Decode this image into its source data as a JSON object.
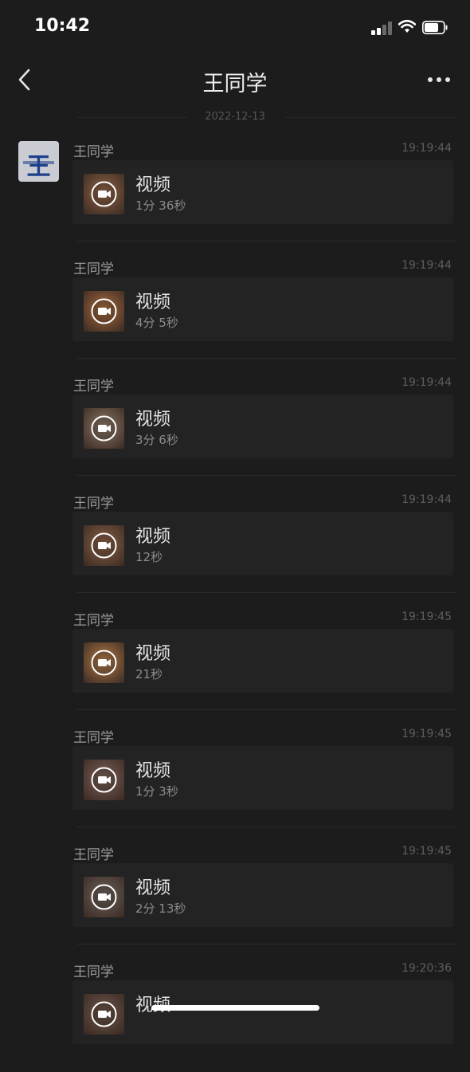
{
  "status_bar": {
    "time": "10:42"
  },
  "nav": {
    "title": "王同学"
  },
  "date_separator": "2022-12-13",
  "avatar": {
    "char": "王"
  },
  "messages": [
    {
      "sender": "王同学",
      "time": "19:19:44",
      "title": "视频",
      "duration": "1分 36秒",
      "thumb_color": "#8f6346"
    },
    {
      "sender": "王同学",
      "time": "19:19:44",
      "title": "视频",
      "duration": "4分 5秒",
      "thumb_color": "#a4693e"
    },
    {
      "sender": "王同学",
      "time": "19:19:44",
      "title": "视频",
      "duration": "3分 6秒",
      "thumb_color": "#8b7666"
    },
    {
      "sender": "王同学",
      "time": "19:19:44",
      "title": "视频",
      "duration": "12秒",
      "thumb_color": "#8a6045"
    },
    {
      "sender": "王同学",
      "time": "19:19:45",
      "title": "视频",
      "duration": "21秒",
      "thumb_color": "#b07b48"
    },
    {
      "sender": "王同学",
      "time": "19:19:45",
      "title": "视频",
      "duration": "1分 3秒",
      "thumb_color": "#7b5f58"
    },
    {
      "sender": "王同学",
      "time": "19:19:45",
      "title": "视频",
      "duration": "2分 13秒",
      "thumb_color": "#6d625c"
    },
    {
      "sender": "王同学",
      "time": "19:20:36",
      "title": "视频",
      "duration": "",
      "thumb_color": "#6b5448"
    }
  ]
}
